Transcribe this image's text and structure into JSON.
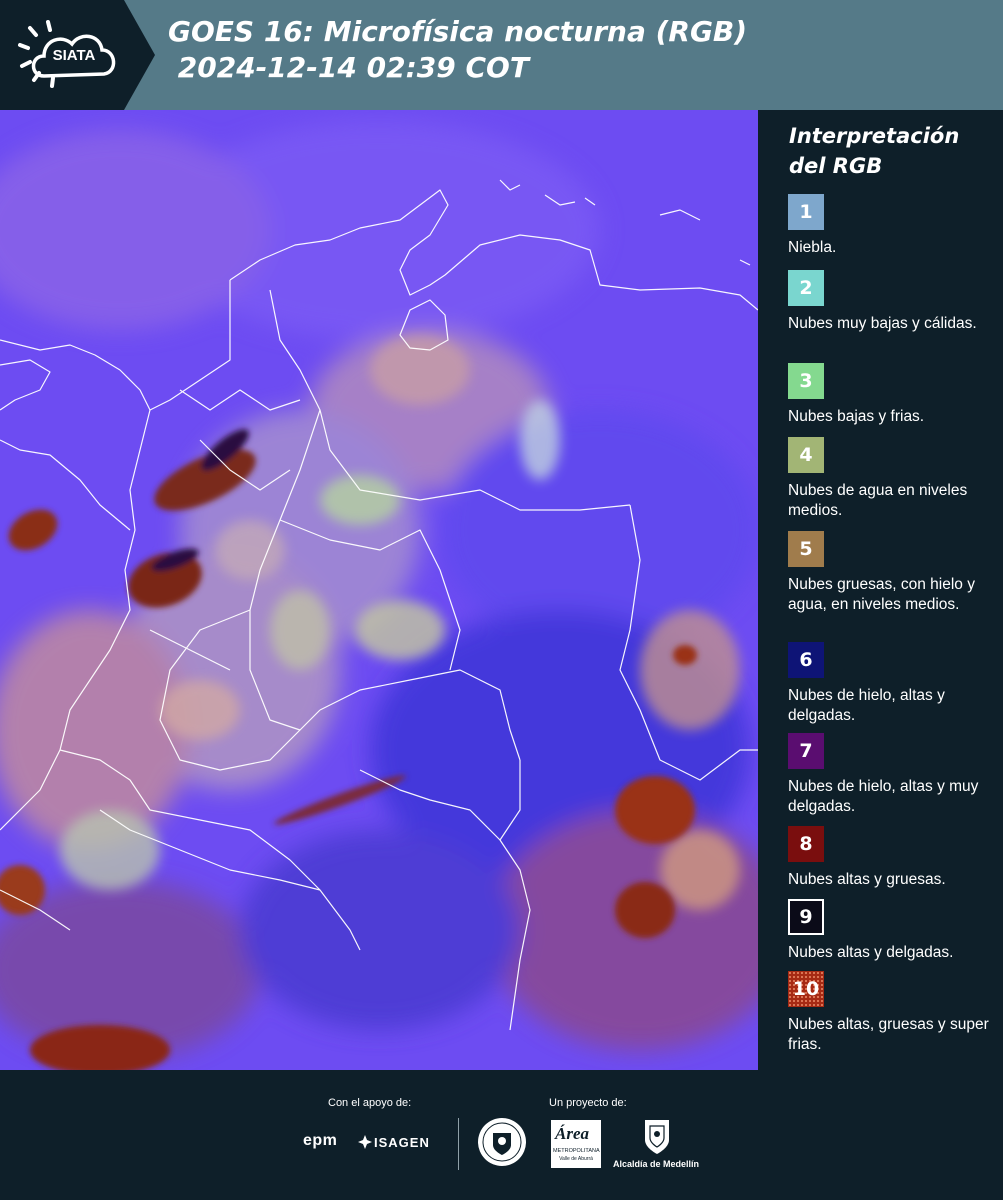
{
  "header": {
    "logo_text": "SIATA",
    "title_line1": "GOES 16: Microfísica nocturna (RGB)",
    "title_line2": " 2024-12-14 02:39 COT"
  },
  "legend": {
    "title": "Interpretación del RGB",
    "items": [
      {
        "number": "1",
        "label": "Niebla.",
        "color": "#7ea7cc"
      },
      {
        "number": "2",
        "label": "Nubes muy bajas y cálidas.",
        "color": "#7ad6cf"
      },
      {
        "number": "3",
        "label": "Nubes bajas y frias.",
        "color": "#84d98f"
      },
      {
        "number": "4",
        "label": "Nubes de agua en niveles medios.",
        "color": "#a2b575"
      },
      {
        "number": "5",
        "label": "Nubes gruesas, con hielo y agua, en niveles medios.",
        "color": "#a07c4c"
      },
      {
        "number": "6",
        "label": "Nubes de hielo, altas y delgadas.",
        "color": "#0e1476"
      },
      {
        "number": "7",
        "label": "Nubes de hielo, altas y muy delgadas.",
        "color": "#5a0d70"
      },
      {
        "number": "8",
        "label": "Nubes altas y gruesas.",
        "color": "#7a0e0e"
      },
      {
        "number": "9",
        "label": "Nubes altas y delgadas.",
        "color": "#0b0b18"
      },
      {
        "number": "10",
        "label": "Nubes altas, gruesas y super frias.",
        "color": "#a62a14"
      }
    ]
  },
  "footer": {
    "support_label": "Con el apoyo de:",
    "project_label": "Un proyecto de:",
    "sponsors": [
      "epm",
      "ISAGEN"
    ],
    "partner_area_title": "Área",
    "partner_area_sub": "METROPOLITANA",
    "partner_area_sub2": "Valle de Aburrá",
    "partner_medellin": "Alcaldía de Medellín"
  }
}
